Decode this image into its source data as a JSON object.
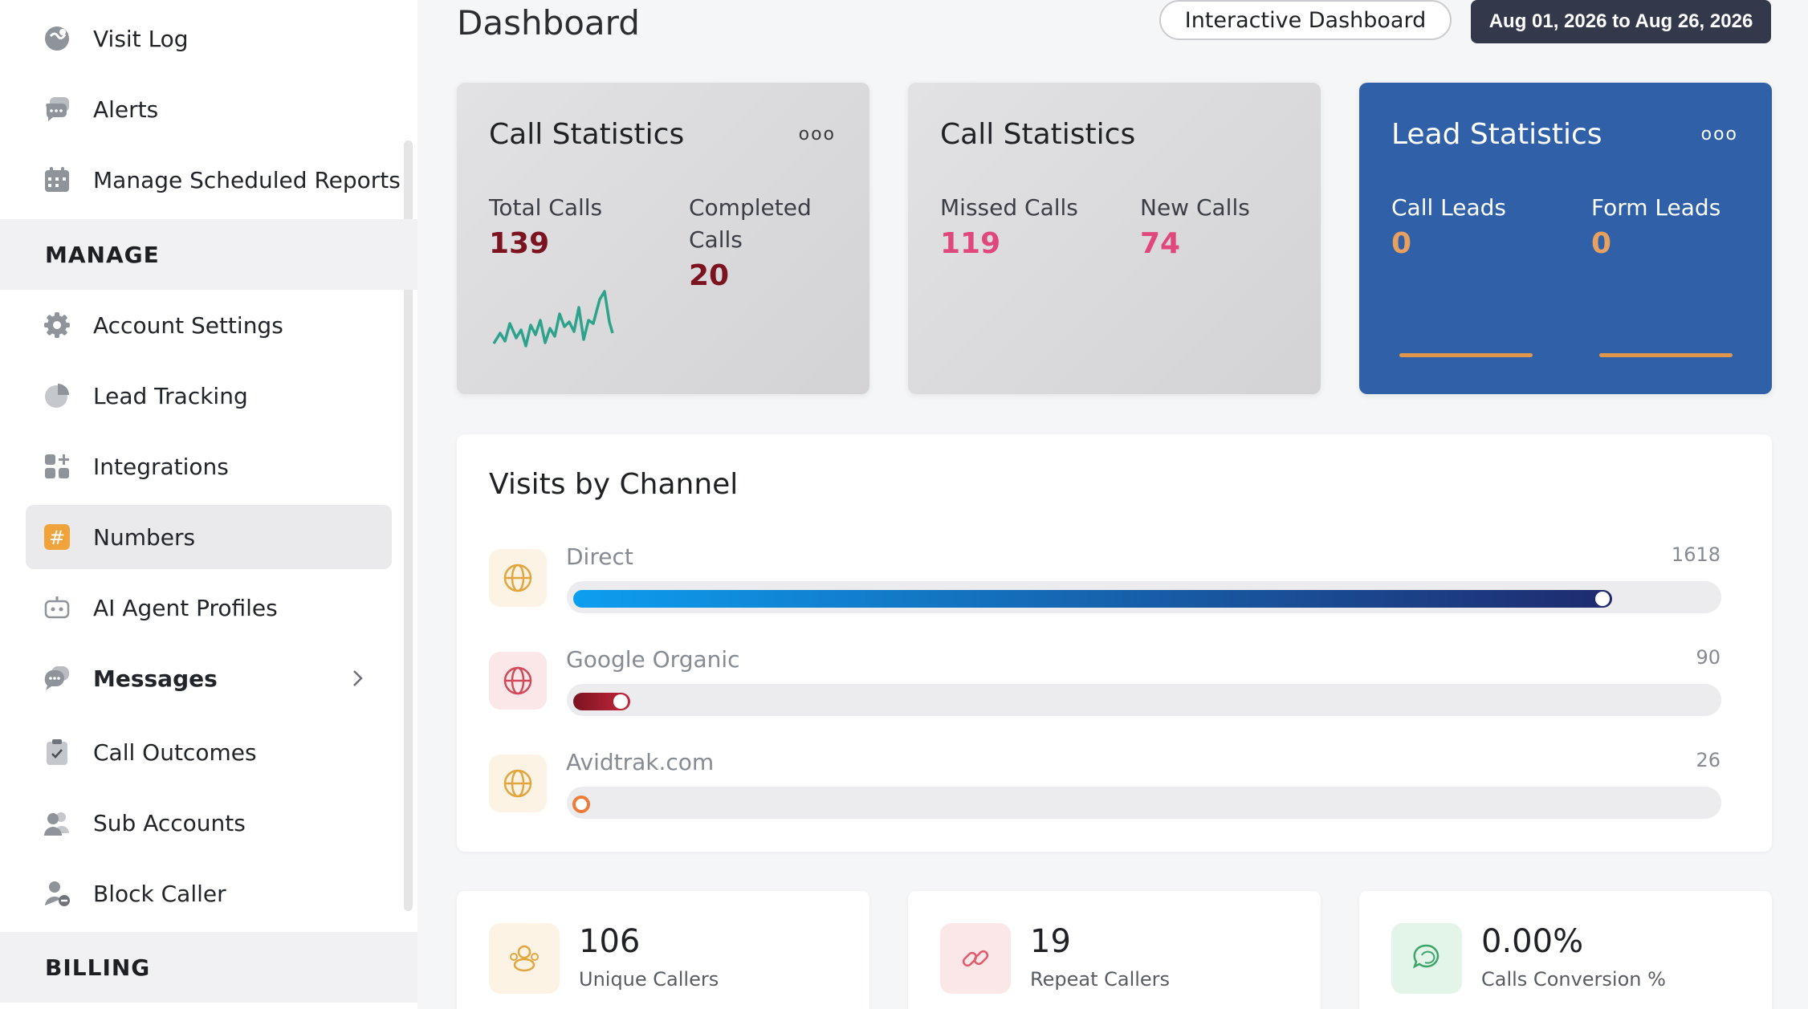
{
  "sidebar": {
    "items_top": [
      {
        "label": "Visit Log",
        "icon": "visit-log-icon"
      },
      {
        "label": "Alerts",
        "icon": "chat-bubble-icon"
      },
      {
        "label": "Manage Scheduled Reports",
        "icon": "calendar-icon"
      }
    ],
    "section_manage": "MANAGE",
    "items_manage": [
      {
        "label": "Account Settings",
        "icon": "gear-icon"
      },
      {
        "label": "Lead Tracking",
        "icon": "pie-chart-icon"
      },
      {
        "label": "Integrations",
        "icon": "apps-plus-icon"
      },
      {
        "label": "Numbers",
        "icon": "hash-icon",
        "active": true
      },
      {
        "label": "AI Agent Profiles",
        "icon": "robot-icon"
      },
      {
        "label": "Messages",
        "icon": "messages-icon"
      },
      {
        "label": "Call Outcomes",
        "icon": "clipboard-check-icon"
      },
      {
        "label": "Sub Accounts",
        "icon": "users-icon"
      },
      {
        "label": "Block Caller",
        "icon": "user-block-icon"
      }
    ],
    "section_billing": "BILLING"
  },
  "header": {
    "title": "Dashboard",
    "interactive_button": "Interactive Dashboard",
    "date_range": "Aug 01, 2026 to Aug 26, 2026"
  },
  "cards": {
    "call_stats_1": {
      "title": "Call Statistics",
      "dots": "ooo",
      "total_label": "Total Calls",
      "total_value": "139",
      "completed_label_1": "Completed",
      "completed_label_2": "Calls",
      "completed_value": "20"
    },
    "call_stats_2": {
      "title": "Call Statistics",
      "missed_label": "Missed Calls",
      "missed_value": "119",
      "new_label": "New Calls",
      "new_value": "74"
    },
    "lead_stats": {
      "title": "Lead Statistics",
      "dots": "ooo",
      "call_leads_label": "Call Leads",
      "call_leads_value": "0",
      "form_leads_label": "Form Leads",
      "form_leads_value": "0"
    }
  },
  "visits": {
    "title": "Visits by Channel",
    "max_value": 1618,
    "channels": [
      {
        "name": "Direct",
        "value": "1618",
        "fill_fraction": 0.91,
        "color_start": "#0d9ef0",
        "color_end": "#1f2a6e",
        "icon_bg": "#fdf3e4",
        "icon_color": "#e3a53d"
      },
      {
        "name": "Google Organic",
        "value": "90",
        "fill_fraction": 0.05,
        "color_start": "#7c1321",
        "color_end": "#c5283d",
        "icon_bg": "#fbe6e8",
        "icon_color": "#d24a5a"
      },
      {
        "name": "Avidtrak.com",
        "value": "26",
        "fill_fraction": 0.016,
        "color_start": "#ef7b3b",
        "color_end": "#ef7b3b",
        "icon_bg": "#fdf3e4",
        "icon_color": "#e3a53d"
      }
    ]
  },
  "summary": [
    {
      "value": "106",
      "label": "Unique Callers",
      "icon": "users-circle-icon",
      "bg": "#fdf3e4",
      "color": "#e3a53d"
    },
    {
      "value": "19",
      "label": "Repeat Callers",
      "icon": "link-icon",
      "bg": "#fbe6e8",
      "color": "#e05a6a"
    },
    {
      "value": "0.00%",
      "label": "Calls Conversion %",
      "icon": "chat-icon",
      "bg": "#e3f4e9",
      "color": "#3ba56a"
    }
  ]
}
